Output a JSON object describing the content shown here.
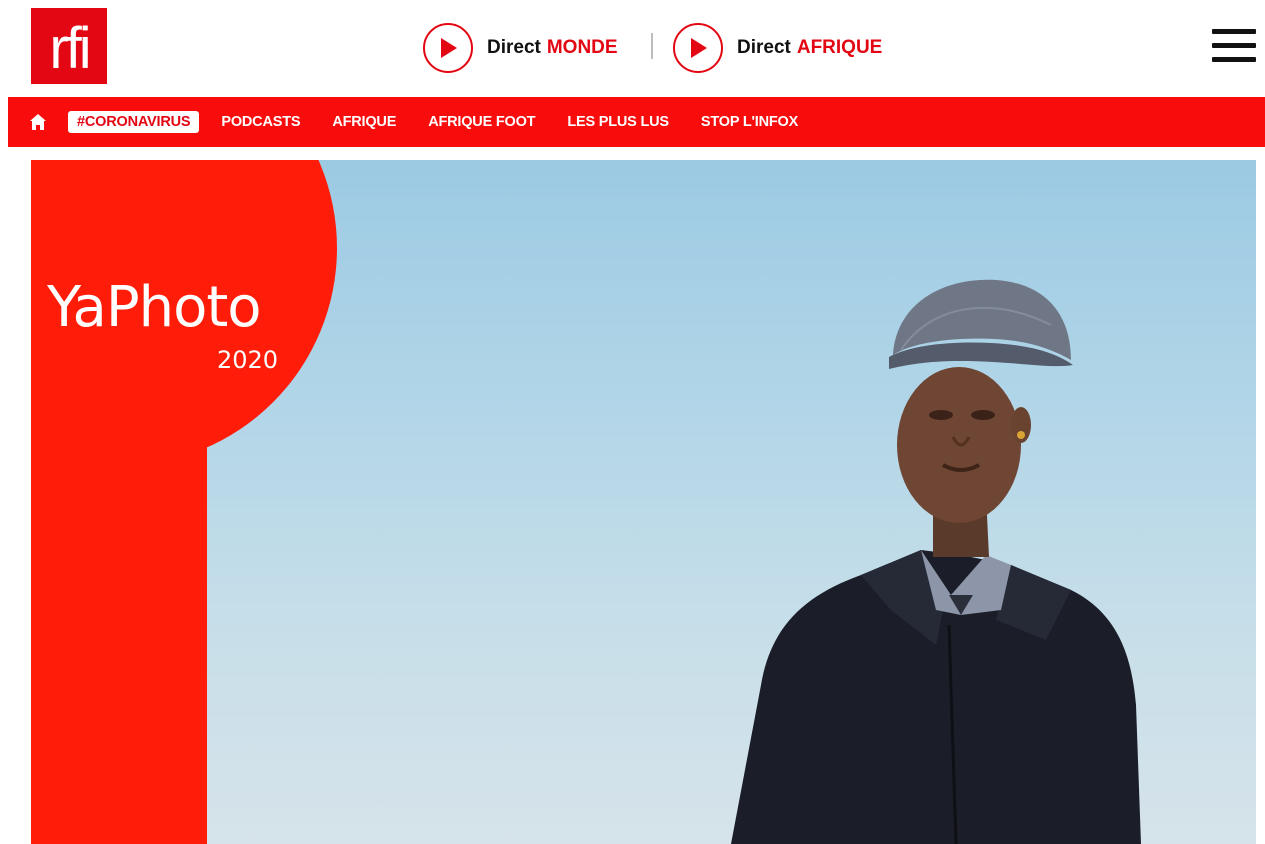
{
  "header": {
    "logo_text": "rfi",
    "live": [
      {
        "label": "Direct",
        "accent": "MONDE"
      },
      {
        "label": "Direct",
        "accent": "AFRIQUE"
      }
    ],
    "menu_icon": "hamburger-menu-icon"
  },
  "nav": {
    "home_icon": "home-icon",
    "items": [
      {
        "label": "#CORONAVIRUS",
        "active": true
      },
      {
        "label": "PODCASTS"
      },
      {
        "label": "AFRIQUE"
      },
      {
        "label": "AFRIQUE FOOT"
      },
      {
        "label": "LES PLUS LUS"
      },
      {
        "label": "STOP L'INFOX"
      }
    ]
  },
  "hero": {
    "title": "YaPhoto",
    "year": "2020"
  },
  "colors": {
    "brand_red": "#e30613",
    "nav_red": "#f80c0c",
    "badge_red": "#ff1d0a",
    "sky": "#b3d6e8"
  }
}
